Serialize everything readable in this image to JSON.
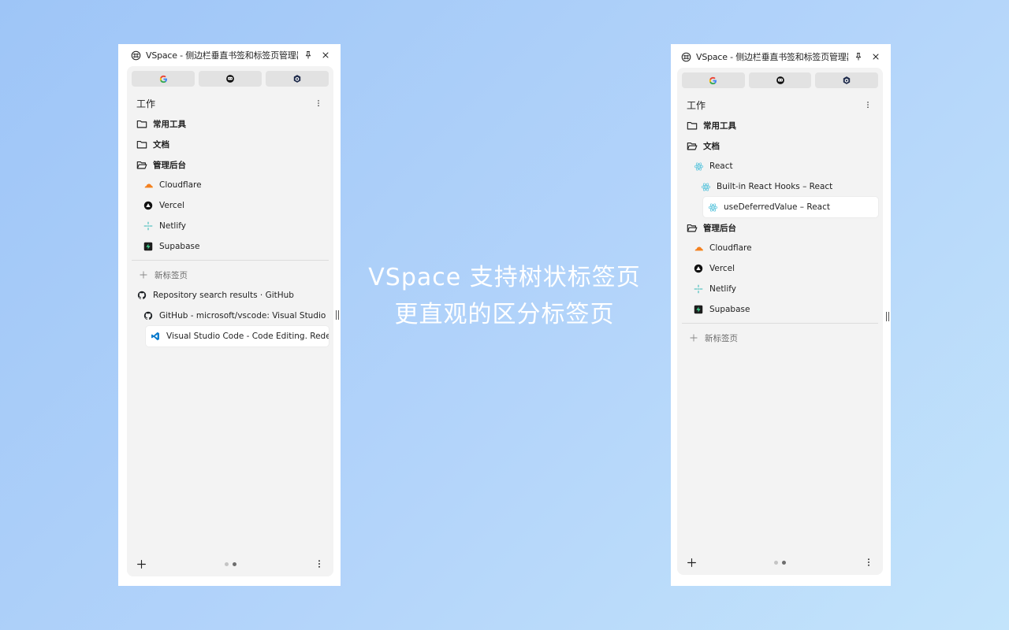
{
  "headline": {
    "line1": "VSpace 支持树状标签页",
    "line2": "更直观的区分标签页"
  },
  "left_panel": {
    "window_title": "VSpace - 侧边栏垂直书签和标签页管理器",
    "pinned": [
      {
        "name": "google-icon"
      },
      {
        "name": "chat-icon"
      },
      {
        "name": "cube-icon"
      }
    ],
    "space_name": "工作",
    "folders": [
      {
        "label": "常用工具",
        "open": false
      },
      {
        "label": "文档",
        "open": false
      },
      {
        "label": "管理后台",
        "open": true
      }
    ],
    "bookmarks": [
      {
        "label": "Cloudflare",
        "icon": "cloudflare-icon"
      },
      {
        "label": "Vercel",
        "icon": "vercel-icon"
      },
      {
        "label": "Netlify",
        "icon": "netlify-icon"
      },
      {
        "label": "Supabase",
        "icon": "supabase-icon"
      }
    ],
    "new_tab_label": "新标签页",
    "tabs": [
      {
        "label": "Repository search results · GitHub",
        "icon": "github-icon",
        "level": 0
      },
      {
        "label": "GitHub - microsoft/vscode: Visual Studio Code",
        "icon": "github-icon",
        "level": 1
      },
      {
        "label": "Visual Studio Code - Code Editing. Redefined",
        "icon": "vscode-icon",
        "level": 2,
        "active": true
      }
    ],
    "page_index": 2,
    "page_count": 2
  },
  "right_panel": {
    "window_title": "VSpace - 侧边栏垂直书签和标签页管理器",
    "space_name": "工作",
    "folders_top": [
      {
        "label": "常用工具",
        "open": false
      },
      {
        "label": "文档",
        "open": true
      }
    ],
    "react_tree": [
      {
        "label": "React",
        "level": 1
      },
      {
        "label": "Built-in React Hooks – React",
        "level": 2
      },
      {
        "label": "useDeferredValue – React",
        "level": 3,
        "active": true
      }
    ],
    "folder_admin": {
      "label": "管理后台",
      "open": true
    },
    "bookmarks": [
      {
        "label": "Cloudflare",
        "icon": "cloudflare-icon"
      },
      {
        "label": "Vercel",
        "icon": "vercel-icon"
      },
      {
        "label": "Netlify",
        "icon": "netlify-icon"
      },
      {
        "label": "Supabase",
        "icon": "supabase-icon"
      }
    ],
    "new_tab_label": "新标签页",
    "page_index": 2,
    "page_count": 2
  },
  "colors": {
    "background_start": "#9ec5f7",
    "background_end": "#c3e4fb",
    "panel_inner": "#f3f3f3",
    "cloudflare": "#f38020",
    "netlify": "#32b7b5",
    "supabase": "#3ecf8e",
    "react": "#58c4dc",
    "vscode": "#0a7acc"
  }
}
